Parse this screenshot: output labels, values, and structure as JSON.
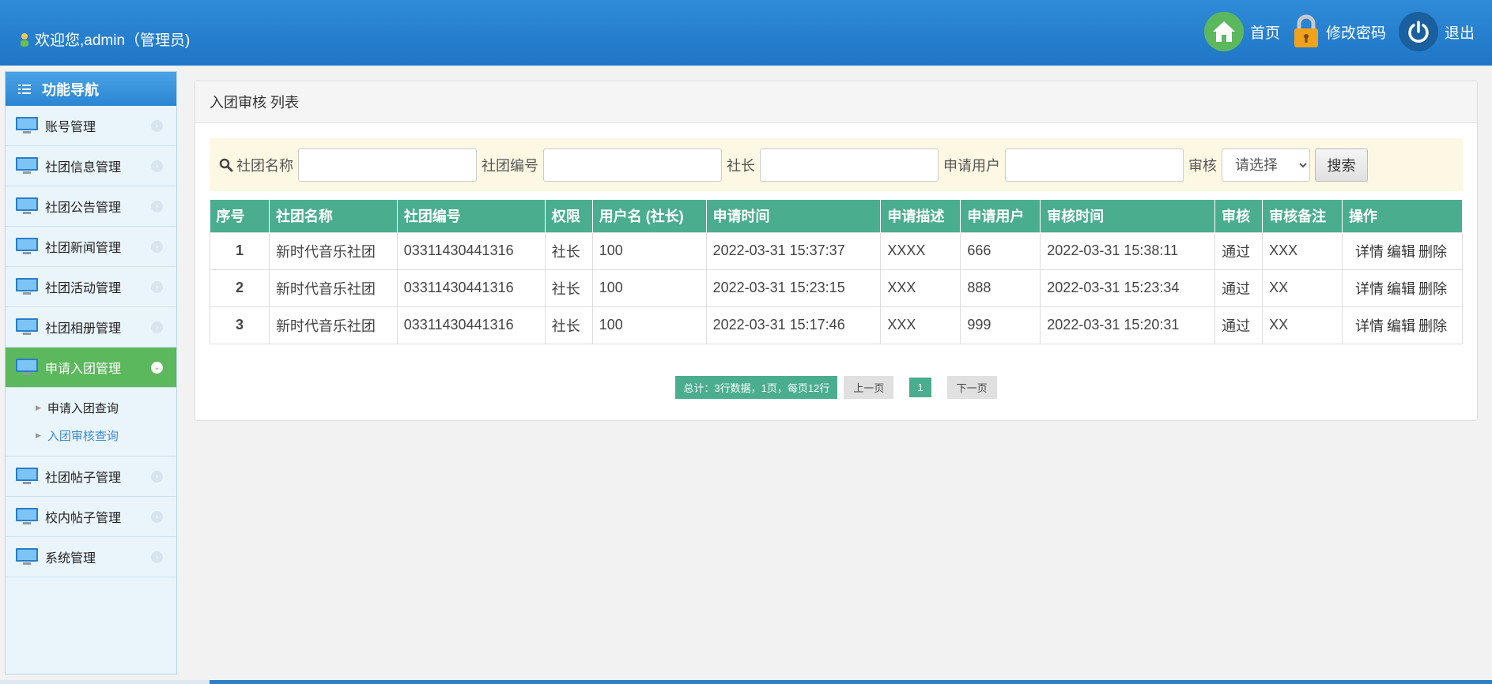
{
  "header": {
    "welcome": "欢迎您,admin（管理员)",
    "home_label": "首页",
    "password_label": "修改密码",
    "logout_label": "退出"
  },
  "sidebar": {
    "title": "功能导航",
    "items": [
      {
        "label": "账号管理"
      },
      {
        "label": "社团信息管理"
      },
      {
        "label": "社团公告管理"
      },
      {
        "label": "社团新闻管理"
      },
      {
        "label": "社团活动管理"
      },
      {
        "label": "社团相册管理"
      },
      {
        "label": "申请入团管理"
      },
      {
        "label": "社团帖子管理"
      },
      {
        "label": "校内帖子管理"
      },
      {
        "label": "系统管理"
      }
    ],
    "submenu": [
      {
        "label": "申请入团查询"
      },
      {
        "label": "入团审核查询"
      }
    ]
  },
  "panel": {
    "title": "入团审核 列表"
  },
  "search": {
    "club_name_label": "社团名称",
    "club_no_label": "社团编号",
    "leader_label": "社长",
    "applicant_label": "申请用户",
    "review_label": "审核",
    "review_select": "请选择",
    "button": "搜索"
  },
  "table": {
    "headers": [
      "序号",
      "社团名称",
      "社团编号",
      "权限",
      "用户名 (社长)",
      "申请时间",
      "申请描述",
      "申请用户",
      "审核时间",
      "审核",
      "审核备注",
      "操作"
    ],
    "rows": [
      [
        "1",
        "新时代音乐社团",
        "03311430441316",
        "社长",
        "100",
        "2022-03-31 15:37:37",
        "XXXX",
        "666",
        "2022-03-31 15:38:11",
        "通过",
        "XXX"
      ],
      [
        "2",
        "新时代音乐社团",
        "03311430441316",
        "社长",
        "100",
        "2022-03-31 15:23:15",
        "XXX",
        "888",
        "2022-03-31 15:23:34",
        "通过",
        "XX"
      ],
      [
        "3",
        "新时代音乐社团",
        "03311430441316",
        "社长",
        "100",
        "2022-03-31 15:17:46",
        "XXX",
        "999",
        "2022-03-31 15:20:31",
        "通过",
        "XX"
      ]
    ],
    "ops": {
      "detail": "详情",
      "edit": "编辑",
      "delete": "删除"
    }
  },
  "pager": {
    "total": "总计：3行数据，1页，每页12行",
    "prev": "上一页",
    "current": "1",
    "next": "下一页"
  },
  "colors": {
    "header_blue": "#2f8bd8",
    "table_header_green": "#4aae8e",
    "active_menu_green": "#5cb85c",
    "search_bg": "#fcf8e3"
  }
}
